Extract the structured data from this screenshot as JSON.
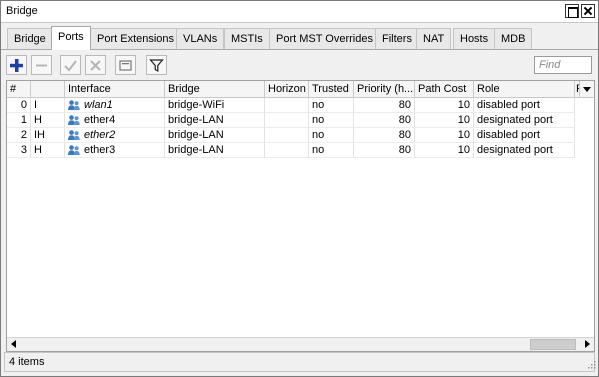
{
  "window": {
    "title": "Bridge"
  },
  "tabs": [
    "Bridge",
    "Ports",
    "Port Extensions",
    "VLANs",
    "MSTIs",
    "Port MST Overrides",
    "Filters",
    "NAT",
    "Hosts",
    "MDB"
  ],
  "active_tab": "Ports",
  "toolbar": {
    "find_placeholder": "Find",
    "icons": [
      "plus-icon",
      "minus-icon",
      "check-icon",
      "x-icon",
      "comment-icon",
      "filter-icon"
    ],
    "accent": "#1f3fa8"
  },
  "table": {
    "columns": [
      "#",
      "",
      "Interface",
      "Bridge",
      "Horizon",
      "Trusted",
      "Priority (h...",
      "Path Cost",
      "Role",
      "R"
    ],
    "rows": [
      {
        "num": "0",
        "flags": "I",
        "interface": "wlan1",
        "italic": true,
        "bridge": "bridge-WiFi",
        "horizon": "",
        "trusted": "no",
        "priority": "80",
        "path_cost": "10",
        "role": "disabled port"
      },
      {
        "num": "1",
        "flags": "H",
        "interface": "ether4",
        "italic": false,
        "bridge": "bridge-LAN",
        "horizon": "",
        "trusted": "no",
        "priority": "80",
        "path_cost": "10",
        "role": "designated port"
      },
      {
        "num": "2",
        "flags": "IH",
        "interface": "ether2",
        "italic": true,
        "bridge": "bridge-LAN",
        "horizon": "",
        "trusted": "no",
        "priority": "80",
        "path_cost": "10",
        "role": "disabled port"
      },
      {
        "num": "3",
        "flags": "H",
        "interface": "ether3",
        "italic": false,
        "bridge": "bridge-LAN",
        "horizon": "",
        "trusted": "no",
        "priority": "80",
        "path_cost": "10",
        "role": "designated port"
      }
    ]
  },
  "status": {
    "text": "4 items"
  }
}
